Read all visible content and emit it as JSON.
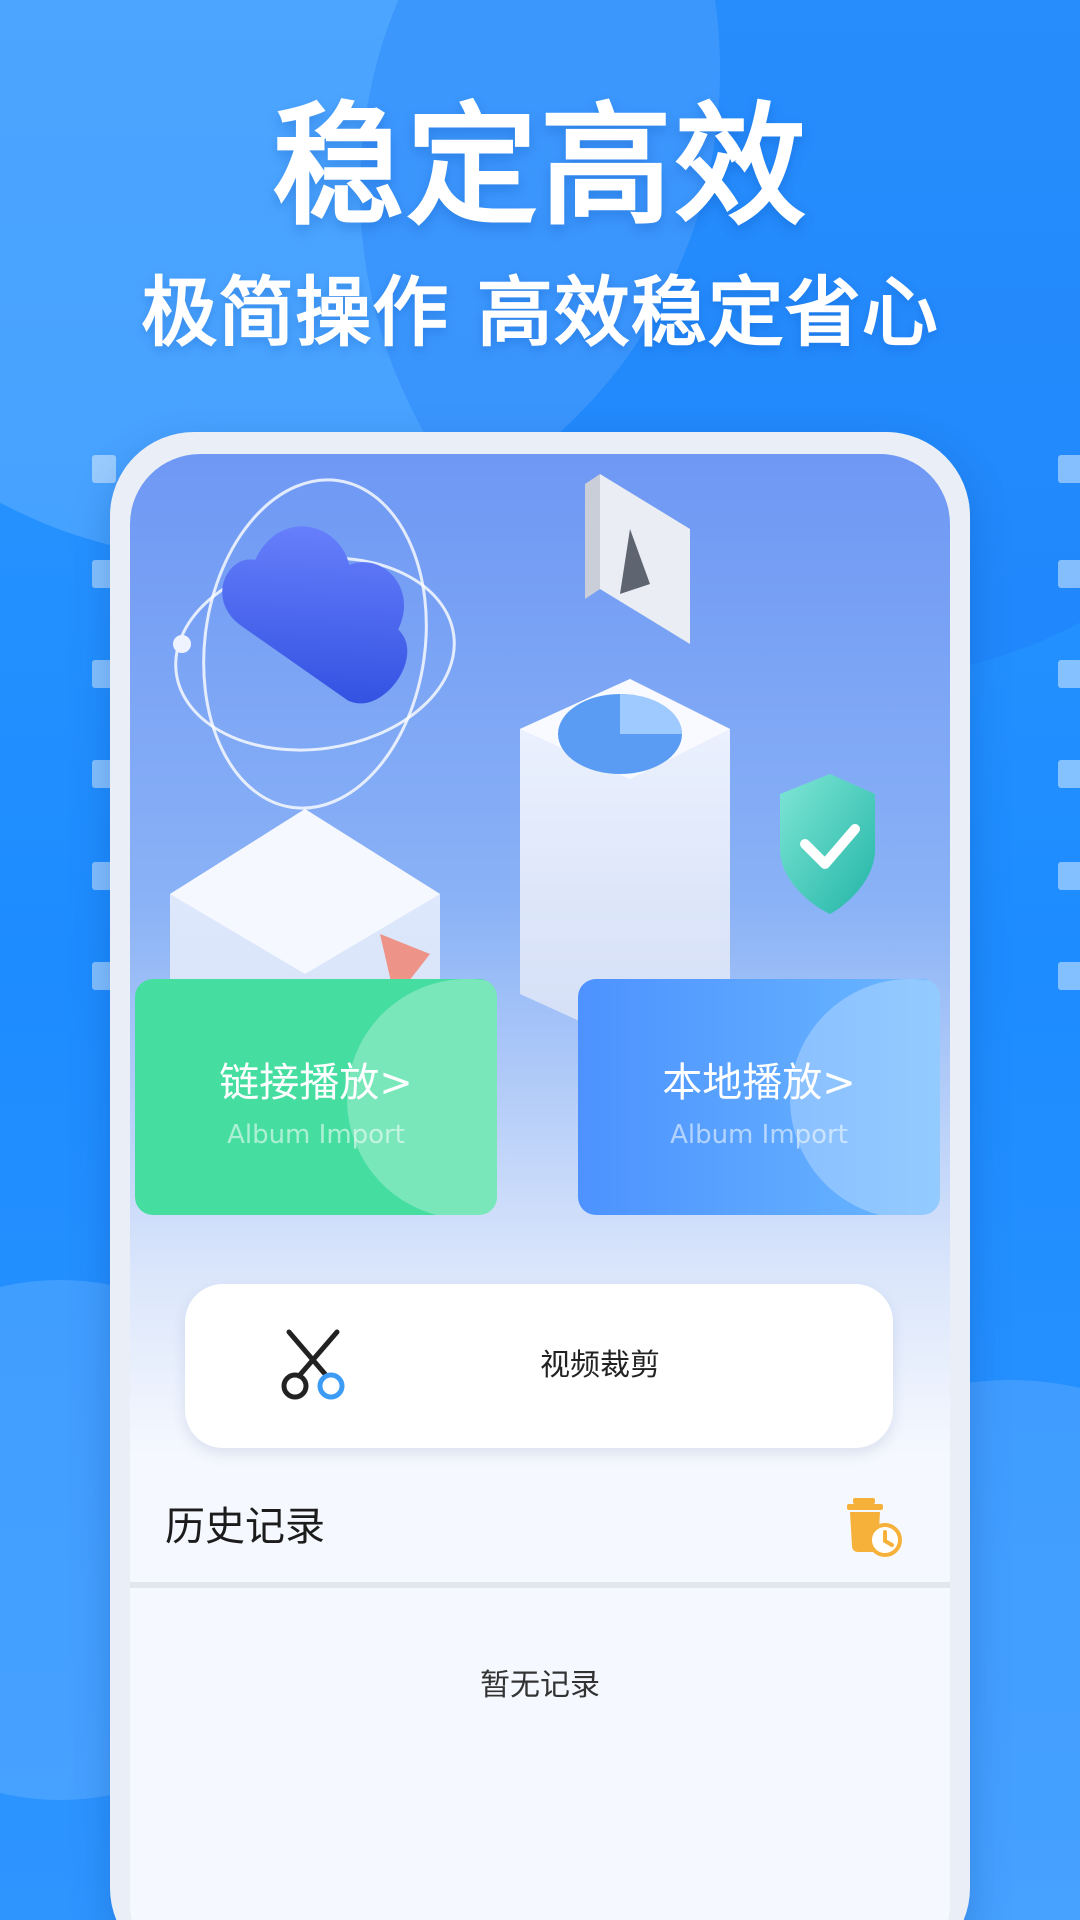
{
  "promo": {
    "headline": "稳定高效",
    "subline": "极简操作 高效稳定省心"
  },
  "cards": {
    "link_play": {
      "title": "链接播放>",
      "subtitle": "Album Import"
    },
    "local_play": {
      "title": "本地播放>",
      "subtitle": "Album Import"
    }
  },
  "video_trim": {
    "label": "视频裁剪",
    "icon": "scissors-icon"
  },
  "history": {
    "title": "历史记录",
    "clear_icon": "trash-clock-icon",
    "empty_text": "暂无记录"
  },
  "colors": {
    "background": "#1b8fff",
    "green_card": "#46dea0",
    "blue_card": "#4d92ff",
    "history_icon": "#f6b13a"
  }
}
